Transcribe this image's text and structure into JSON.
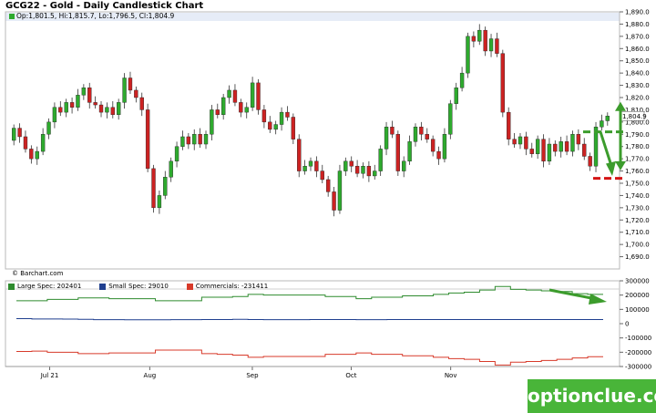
{
  "header": {
    "title": "GCG22 - Gold - Daily Candlestick Chart",
    "ohlc": "Op:1,801.5, Hi:1,815.7, Lo:1,796.5, Cl:1,804.9"
  },
  "copyright": "© Barchart.com",
  "last_price_label": "1,804.9",
  "watermark": "optionclue.com",
  "colors": {
    "up": "#2eaa2e",
    "down": "#cc2222",
    "large_spec": "#2e8b2e",
    "small_spec": "#1f3f8f",
    "commercials": "#d83a2a",
    "annotation": "#3c9c2c"
  },
  "chart_data": [
    {
      "type": "candlestick",
      "title": "GCG22 - Gold - Daily Candlestick Chart",
      "ylim": [
        1680,
        1890
      ],
      "y_ticks": [
        "1,890.0",
        "1,880.0",
        "1,870.0",
        "1,860.0",
        "1,850.0",
        "1,840.0",
        "1,830.0",
        "1,820.0",
        "1,810.0",
        "1,800.0",
        "1,790.0",
        "1,780.0",
        "1,770.0",
        "1,760.0",
        "1,750.0",
        "1,740.0",
        "1,730.0",
        "1,720.0",
        "1,710.0",
        "1,700.0",
        "1,690.0"
      ],
      "x_labels": [
        "Jul 21",
        "Aug",
        "Sep",
        "Oct",
        "Nov"
      ],
      "last": 1804.9,
      "candles": [
        {
          "o": 1785,
          "c": 1795
        },
        {
          "o": 1795,
          "c": 1788
        },
        {
          "o": 1788,
          "c": 1778
        },
        {
          "o": 1778,
          "c": 1770
        },
        {
          "o": 1770,
          "c": 1776
        },
        {
          "o": 1776,
          "c": 1790
        },
        {
          "o": 1790,
          "c": 1800
        },
        {
          "o": 1800,
          "c": 1812
        },
        {
          "o": 1812,
          "c": 1808
        },
        {
          "o": 1808,
          "c": 1816
        },
        {
          "o": 1816,
          "c": 1812
        },
        {
          "o": 1812,
          "c": 1822
        },
        {
          "o": 1822,
          "c": 1828
        },
        {
          "o": 1828,
          "c": 1816
        },
        {
          "o": 1816,
          "c": 1814
        },
        {
          "o": 1814,
          "c": 1808
        },
        {
          "o": 1808,
          "c": 1812
        },
        {
          "o": 1812,
          "c": 1806
        },
        {
          "o": 1806,
          "c": 1816
        },
        {
          "o": 1816,
          "c": 1836
        },
        {
          "o": 1836,
          "c": 1826
        },
        {
          "o": 1826,
          "c": 1820
        },
        {
          "o": 1820,
          "c": 1810
        },
        {
          "o": 1810,
          "c": 1762
        },
        {
          "o": 1762,
          "c": 1730
        },
        {
          "o": 1730,
          "c": 1740
        },
        {
          "o": 1740,
          "c": 1755
        },
        {
          "o": 1755,
          "c": 1768
        },
        {
          "o": 1768,
          "c": 1780
        },
        {
          "o": 1780,
          "c": 1788
        },
        {
          "o": 1788,
          "c": 1782
        },
        {
          "o": 1782,
          "c": 1790
        },
        {
          "o": 1790,
          "c": 1782
        },
        {
          "o": 1782,
          "c": 1790
        },
        {
          "o": 1790,
          "c": 1810
        },
        {
          "o": 1810,
          "c": 1806
        },
        {
          "o": 1806,
          "c": 1820
        },
        {
          "o": 1820,
          "c": 1826
        },
        {
          "o": 1826,
          "c": 1816
        },
        {
          "o": 1816,
          "c": 1808
        },
        {
          "o": 1808,
          "c": 1812
        },
        {
          "o": 1812,
          "c": 1832
        },
        {
          "o": 1832,
          "c": 1810
        },
        {
          "o": 1810,
          "c": 1800
        },
        {
          "o": 1800,
          "c": 1794
        },
        {
          "o": 1794,
          "c": 1798
        },
        {
          "o": 1798,
          "c": 1808
        },
        {
          "o": 1808,
          "c": 1804
        },
        {
          "o": 1804,
          "c": 1786
        },
        {
          "o": 1786,
          "c": 1760
        },
        {
          "o": 1760,
          "c": 1764
        },
        {
          "o": 1764,
          "c": 1768
        },
        {
          "o": 1768,
          "c": 1760
        },
        {
          "o": 1760,
          "c": 1753
        },
        {
          "o": 1753,
          "c": 1743
        },
        {
          "o": 1743,
          "c": 1728
        },
        {
          "o": 1728,
          "c": 1760
        },
        {
          "o": 1760,
          "c": 1768
        },
        {
          "o": 1768,
          "c": 1764
        },
        {
          "o": 1764,
          "c": 1758
        },
        {
          "o": 1758,
          "c": 1764
        },
        {
          "o": 1764,
          "c": 1756
        },
        {
          "o": 1756,
          "c": 1760
        },
        {
          "o": 1760,
          "c": 1778
        },
        {
          "o": 1778,
          "c": 1796
        },
        {
          "o": 1796,
          "c": 1790
        },
        {
          "o": 1790,
          "c": 1760
        },
        {
          "o": 1760,
          "c": 1768
        },
        {
          "o": 1768,
          "c": 1784
        },
        {
          "o": 1784,
          "c": 1796
        },
        {
          "o": 1796,
          "c": 1790
        },
        {
          "o": 1790,
          "c": 1786
        },
        {
          "o": 1786,
          "c": 1776
        },
        {
          "o": 1776,
          "c": 1770
        },
        {
          "o": 1770,
          "c": 1790
        },
        {
          "o": 1790,
          "c": 1815
        },
        {
          "o": 1815,
          "c": 1828
        },
        {
          "o": 1828,
          "c": 1840
        },
        {
          "o": 1840,
          "c": 1870
        },
        {
          "o": 1870,
          "c": 1866
        },
        {
          "o": 1866,
          "c": 1875
        },
        {
          "o": 1875,
          "c": 1858
        },
        {
          "o": 1858,
          "c": 1868
        },
        {
          "o": 1868,
          "c": 1856
        },
        {
          "o": 1856,
          "c": 1808
        },
        {
          "o": 1808,
          "c": 1786
        },
        {
          "o": 1786,
          "c": 1782
        },
        {
          "o": 1782,
          "c": 1788
        },
        {
          "o": 1788,
          "c": 1778
        },
        {
          "o": 1778,
          "c": 1774
        },
        {
          "o": 1774,
          "c": 1786
        },
        {
          "o": 1786,
          "c": 1768
        },
        {
          "o": 1768,
          "c": 1782
        },
        {
          "o": 1782,
          "c": 1776
        },
        {
          "o": 1776,
          "c": 1784
        },
        {
          "o": 1784,
          "c": 1776
        },
        {
          "o": 1776,
          "c": 1790
        },
        {
          "o": 1790,
          "c": 1782
        },
        {
          "o": 1782,
          "c": 1772
        },
        {
          "o": 1772,
          "c": 1764
        },
        {
          "o": 1764,
          "c": 1796
        },
        {
          "o": 1796,
          "c": 1801
        },
        {
          "o": 1801,
          "c": 1804.9
        }
      ],
      "annotations": {
        "support_level": 1754,
        "resistance_level": 1792,
        "arrow_top": 1815,
        "arrow_bottom": 1762
      }
    },
    {
      "type": "line",
      "title": "COT",
      "ylim": [
        -300000,
        300000
      ],
      "y_ticks": [
        "300000",
        "200000",
        "100000",
        "0",
        "-100000",
        "-200000",
        "-300000"
      ],
      "series": [
        {
          "name": "Large Spec: 202401",
          "values": [
            160000,
            160000,
            170000,
            170000,
            180000,
            180000,
            175000,
            175000,
            175000,
            160000,
            160000,
            160000,
            185000,
            185000,
            190000,
            205000,
            200000,
            200000,
            200000,
            200000,
            190000,
            190000,
            175000,
            185000,
            185000,
            195000,
            195000,
            205000,
            215000,
            220000,
            235000,
            260000,
            240000,
            235000,
            230000,
            225000,
            210000,
            205000
          ]
        },
        {
          "name": "Small Spec: 29010",
          "values": [
            35000,
            33000,
            33000,
            32000,
            30000,
            28000,
            28000,
            27000,
            27000,
            27000,
            28000,
            28000,
            29000,
            29000,
            30000,
            29000,
            28000,
            28000,
            28000,
            29000,
            29000,
            29000,
            28000,
            28000,
            29000,
            29000,
            29000,
            29000,
            29000,
            29000,
            29000,
            29000,
            29000,
            29000,
            29000,
            29000,
            29000,
            29010
          ]
        },
        {
          "name": "Commercials: -231411",
          "values": [
            -195000,
            -192000,
            -200000,
            -200000,
            -210000,
            -210000,
            -205000,
            -205000,
            -205000,
            -185000,
            -185000,
            -185000,
            -210000,
            -215000,
            -220000,
            -235000,
            -230000,
            -230000,
            -230000,
            -230000,
            -215000,
            -215000,
            -205000,
            -215000,
            -215000,
            -225000,
            -225000,
            -235000,
            -245000,
            -250000,
            -265000,
            -290000,
            -270000,
            -265000,
            -258000,
            -250000,
            -240000,
            -231411
          ]
        }
      ]
    }
  ]
}
